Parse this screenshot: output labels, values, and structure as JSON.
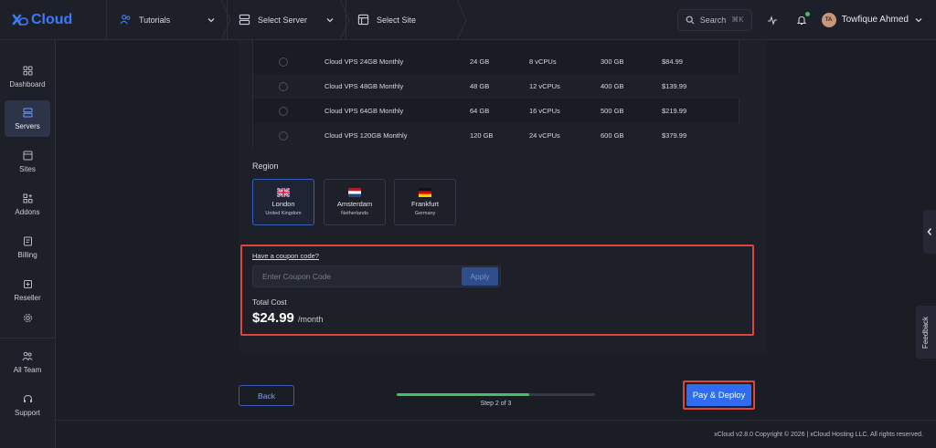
{
  "app": {
    "brand": "Cloud"
  },
  "breadcrumbs": [
    {
      "label": "Tutorials",
      "icon": "team-icon"
    },
    {
      "label": "Select Server",
      "icon": "server-icon"
    },
    {
      "label": "Select Site",
      "icon": "browser-icon"
    }
  ],
  "header": {
    "search_label": "Search",
    "search_shortcut": "⌘K",
    "user_initials": "TA",
    "user_name": "Towfique Ahmed"
  },
  "sidebar": {
    "items": [
      {
        "label": "Dashboard",
        "icon": "dashboard-icon",
        "active": false
      },
      {
        "label": "Servers",
        "icon": "server-icon",
        "active": true
      },
      {
        "label": "Sites",
        "icon": "sites-icon",
        "active": false
      },
      {
        "label": "Addons",
        "icon": "addons-icon",
        "active": false
      },
      {
        "label": "Billing",
        "icon": "billing-icon",
        "active": false
      },
      {
        "label": "Reseller",
        "icon": "reseller-icon",
        "active": false
      },
      {
        "label": "",
        "icon": "settings-icon",
        "active": false
      },
      {
        "label": "All Team",
        "icon": "team-icon",
        "active": false
      },
      {
        "label": "Support",
        "icon": "headset-icon",
        "active": false
      }
    ]
  },
  "plans": [
    {
      "name": "Cloud VPS 24GB Monthly",
      "ram": "24 GB",
      "cpu": "8 vCPUs",
      "disk": "300 GB",
      "price": "$84.99"
    },
    {
      "name": "Cloud VPS 48GB Monthly",
      "ram": "48 GB",
      "cpu": "12 vCPUs",
      "disk": "400 GB",
      "price": "$139.99"
    },
    {
      "name": "Cloud VPS 64GB Monthly",
      "ram": "64 GB",
      "cpu": "16 vCPUs",
      "disk": "500 GB",
      "price": "$219.99"
    },
    {
      "name": "Cloud VPS 120GB Monthly",
      "ram": "120 GB",
      "cpu": "24 vCPUs",
      "disk": "600 GB",
      "price": "$379.99"
    }
  ],
  "region": {
    "label": "Region",
    "options": [
      {
        "name": "London",
        "country": "United Kingdom",
        "flag": "uk-flag-icon",
        "selected": true
      },
      {
        "name": "Amsterdam",
        "country": "Netherlands",
        "flag": "netherlands-flag-icon",
        "selected": false
      },
      {
        "name": "Frankfurt",
        "country": "Germany",
        "flag": "germany-flag-icon",
        "selected": false
      }
    ]
  },
  "coupon": {
    "link_label": "Have a coupon code?",
    "placeholder": "Enter Coupon Code",
    "apply_label": "Apply"
  },
  "total": {
    "label": "Total Cost",
    "price": "$24.99",
    "unit": "/month"
  },
  "wizard": {
    "back_label": "Back",
    "step_text": "Step 2 of 3",
    "progress": 0.67,
    "deploy_label": "Pay & Deploy"
  },
  "footer": {
    "text": "xCloud v2.8.0 Copyright © 2026 | xCloud Hosting LLC. All rights reserved."
  },
  "feedback_label": "Feedback",
  "colors": {
    "accent": "#2f6cf0",
    "highlight": "#e0443b",
    "progress": "#3cc368"
  }
}
